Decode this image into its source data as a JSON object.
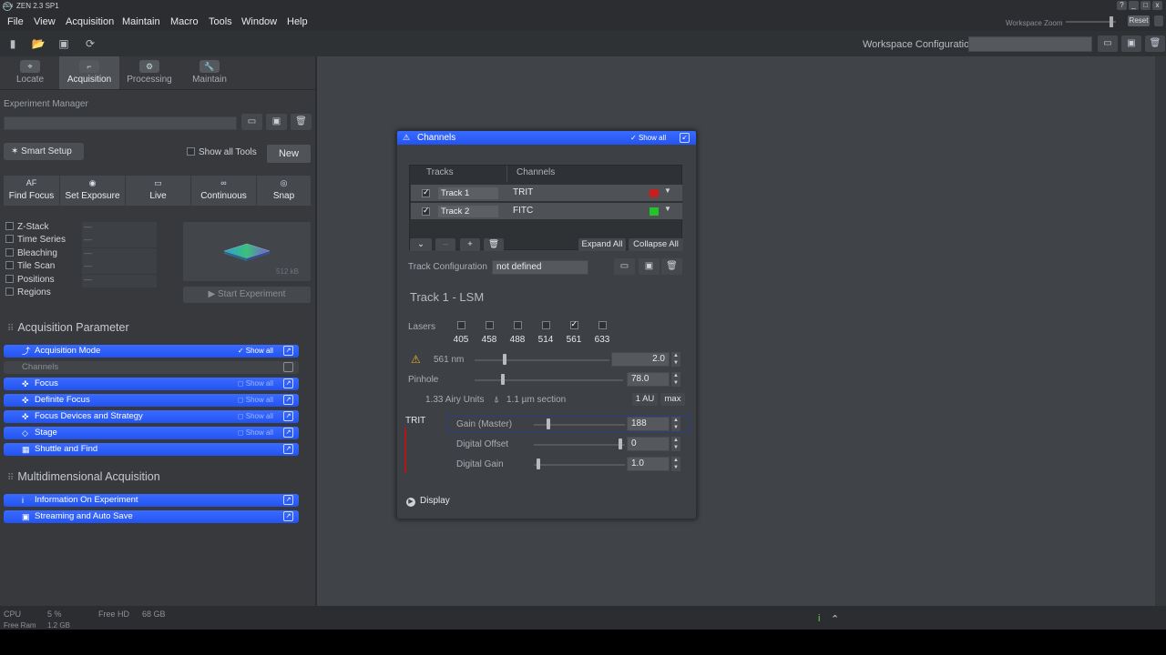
{
  "app": {
    "title": "ZEN 2.3 SP1",
    "logo_text": "ZEN"
  },
  "window_buttons": [
    "?",
    "_",
    "□",
    "x"
  ],
  "menu": [
    "File",
    "View",
    "Acquisition",
    "Maintain",
    "Macro",
    "Tools",
    "Window",
    "Help"
  ],
  "workspace_zoom": {
    "label": "Workspace Zoom",
    "reset": "Reset"
  },
  "toolbar": {
    "workspace_config_label": "Workspace Configuration"
  },
  "tabs": [
    {
      "label": "Locate",
      "icon": "locate-icon"
    },
    {
      "label": "Acquisition",
      "icon": "acquisition-icon",
      "active": true
    },
    {
      "label": "Processing",
      "icon": "processing-icon"
    },
    {
      "label": "Maintain",
      "icon": "maintain-icon"
    }
  ],
  "experiment": {
    "manager_label": "Experiment Manager",
    "smart_setup": "Smart Setup",
    "show_all_tools": "Show all Tools",
    "new_label": "New"
  },
  "acq_buttons": [
    {
      "label": "Find Focus",
      "icon": "AF"
    },
    {
      "label": "Set Exposure",
      "icon": "◉"
    },
    {
      "label": "Live",
      "icon": "▭"
    },
    {
      "label": "Continuous",
      "icon": "∞"
    },
    {
      "label": "Snap",
      "icon": "◎"
    }
  ],
  "options": [
    {
      "label": "Z-Stack",
      "value": "—"
    },
    {
      "label": "Time Series",
      "value": "—"
    },
    {
      "label": "Bleaching",
      "value": "—"
    },
    {
      "label": "Tile Scan",
      "value": "—"
    },
    {
      "label": "Positions",
      "value": "—"
    },
    {
      "label": "Regions",
      "value": ""
    }
  ],
  "preview": {
    "size": "512 kB"
  },
  "start_experiment": "Start Experiment",
  "acq_param": {
    "title": "Acquisition Parameter",
    "items": [
      {
        "label": "Acquisition Mode",
        "show_all": "Show all",
        "active": true,
        "icon": "⤴"
      },
      {
        "label": "Channels",
        "disabled": true
      },
      {
        "label": "Focus",
        "show_all": "Show all",
        "icon": "✜"
      },
      {
        "label": "Definite Focus",
        "show_all": "Show all",
        "icon": "✜"
      },
      {
        "label": "Focus Devices and Strategy",
        "show_all": "Show all",
        "icon": "✜"
      },
      {
        "label": "Stage",
        "show_all": "Show all",
        "icon": "◇"
      },
      {
        "label": "Shuttle and Find",
        "icon": "▦"
      }
    ]
  },
  "multi_acq": {
    "title": "Multidimensional Acquisition",
    "items": [
      {
        "label": "Information On Experiment",
        "icon": "i"
      },
      {
        "label": "Streaming and Auto Save",
        "icon": "▣"
      }
    ]
  },
  "status": {
    "cpu_label": "CPU",
    "cpu_value": "5 %",
    "freehd_label": "Free HD",
    "freehd_value": "68 GB",
    "freeram_label": "Free Ram",
    "freeram_value": "1.2 GB"
  },
  "dialog": {
    "title": "Channels",
    "show_all": "Show all",
    "col_tracks": "Tracks",
    "col_channels": "Channels",
    "tracks": [
      {
        "name": "Track 1",
        "channel": "TRIT",
        "color": "#c81e1e"
      },
      {
        "name": "Track 2",
        "channel": "FITC",
        "color": "#22c42a"
      }
    ],
    "expand_all": "Expand All",
    "collapse_all": "Collapse All",
    "track_config_label": "Track Configuration",
    "track_config_value": "not defined",
    "track_title": "Track 1 - LSM",
    "lasers_label": "Lasers",
    "lasers": [
      {
        "nm": "405",
        "on": false
      },
      {
        "nm": "458",
        "on": false
      },
      {
        "nm": "488",
        "on": false
      },
      {
        "nm": "514",
        "on": false
      },
      {
        "nm": "561",
        "on": true
      },
      {
        "nm": "633",
        "on": false
      }
    ],
    "laser_line": "561 nm",
    "laser_power": "2.0",
    "laser_power_level": 0.22,
    "pinhole_label": "Pinhole",
    "pinhole_value": "78.0",
    "pinhole_level": 0.19,
    "airy": "1.33 Airy Units",
    "section": "1.1 µm section",
    "btn_1au": "1 AU",
    "btn_max": "max",
    "channel_name": "TRIT",
    "gain_label": "Gain (Master)",
    "gain_value": "188",
    "gain_level": 0.16,
    "offset_label": "Digital Offset",
    "offset_value": "0",
    "offset_level": 0.95,
    "dgain_label": "Digital Gain",
    "dgain_value": "1.0",
    "dgain_level": 0.05,
    "display_label": "Display"
  }
}
